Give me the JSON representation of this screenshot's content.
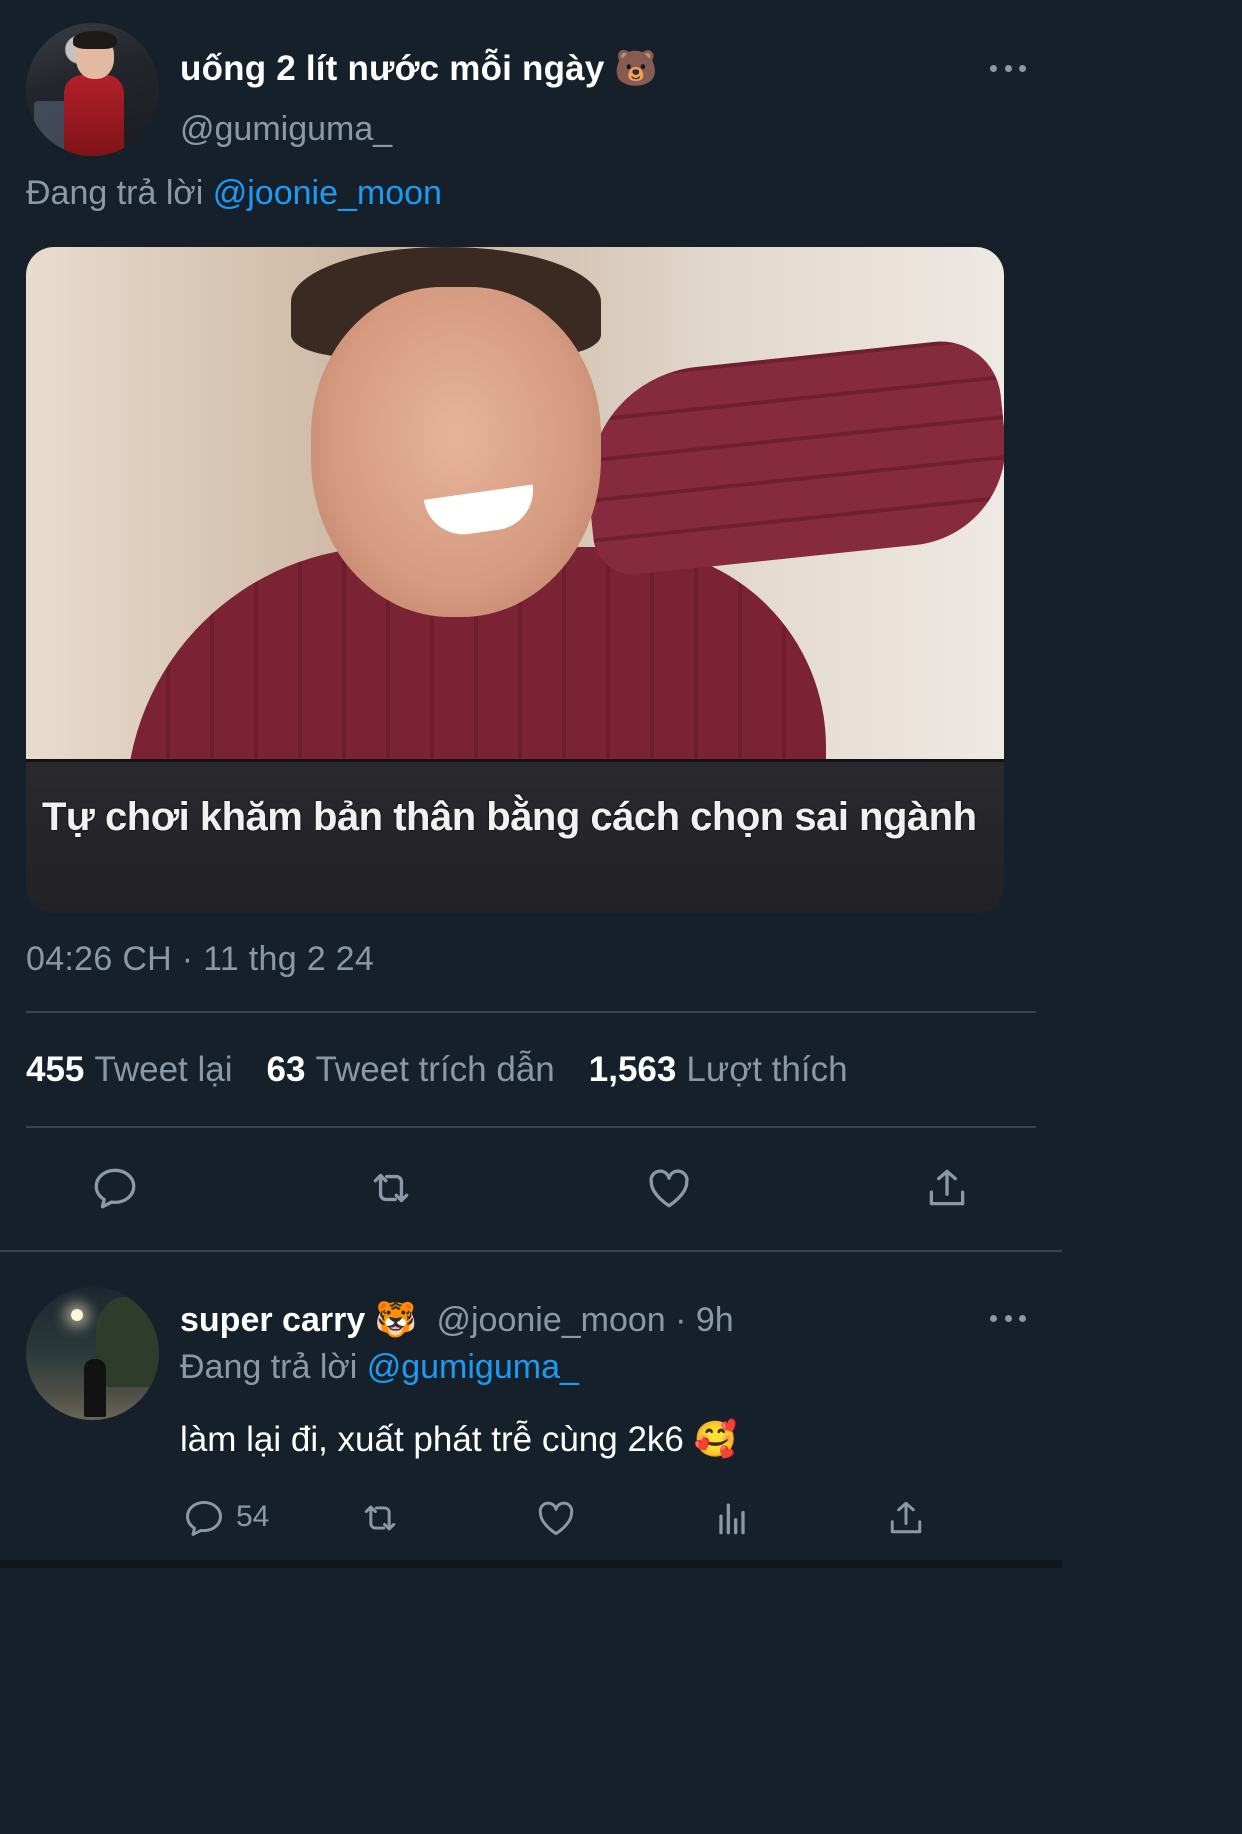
{
  "tweet": {
    "display_name": "uống 2 lít nước mỗi ngày 🐻",
    "handle": "@gumiguma_",
    "replying_prefix": "Đang trả lời",
    "replying_to": "@joonie_moon",
    "media_caption": "Tự chơi khăm bản thân bằng cách chọn sai ngành",
    "timestamp": "04:26 CH · 11 thg 2 24",
    "stats": {
      "retweets_count": "455",
      "retweets_label": "Tweet lại",
      "quotes_count": "63",
      "quotes_label": "Tweet trích dẫn",
      "likes_count": "1,563",
      "likes_label": "Lượt thích"
    },
    "action_icons": [
      "reply-icon",
      "retweet-icon",
      "like-icon",
      "share-icon"
    ]
  },
  "reply": {
    "display_name": "super carry 🐯",
    "handle_time": "@joonie_moon · 9h",
    "replying_prefix": "Đang trả lời",
    "replying_to": "@gumiguma_",
    "text": "làm lại đi, xuất phát trễ cùng 2k6 🥰",
    "reply_count": "54",
    "action_icons": [
      "reply-icon",
      "retweet-icon",
      "like-icon",
      "analytics-icon",
      "share-icon"
    ]
  },
  "colors": {
    "background": "#15202b",
    "secondary_text": "#8b98a5",
    "accent": "#1d9bf0",
    "divider": "#38444d"
  }
}
